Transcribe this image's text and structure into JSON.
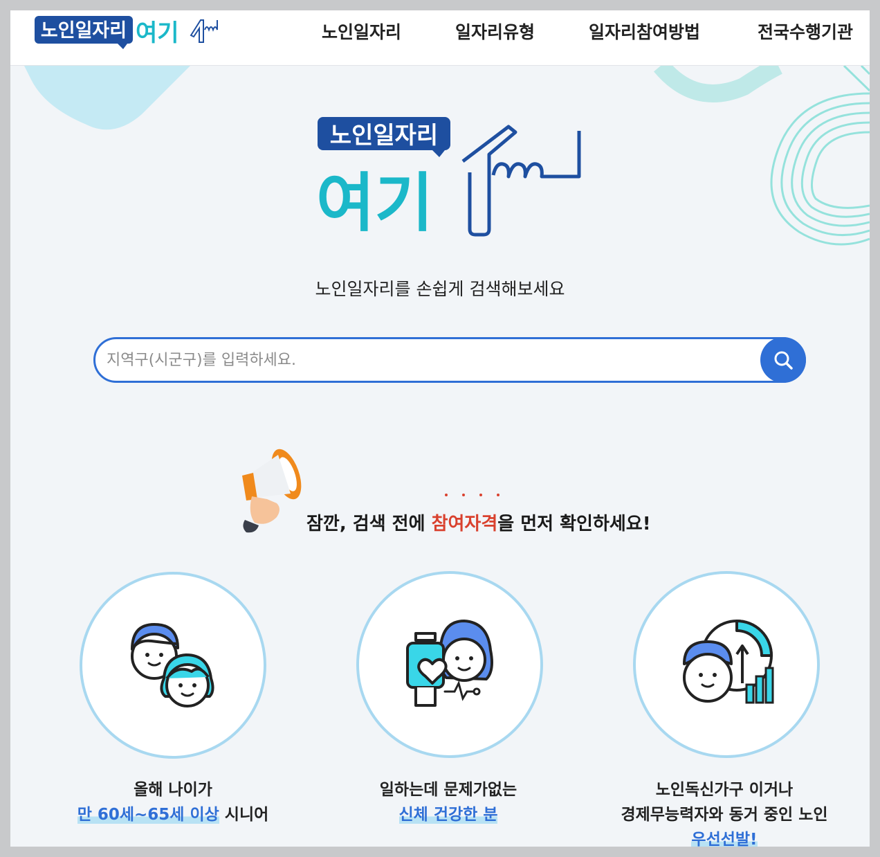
{
  "header": {
    "logo_top": "노인일자리",
    "logo_bottom": "여기",
    "nav": [
      "노인일자리",
      "일자리유형",
      "일자리참여방법",
      "전국수행기관"
    ]
  },
  "hero": {
    "logo_top": "노인일자리",
    "logo_bottom": "여기",
    "tagline": "노인일자리를 손쉽게 검색해보세요"
  },
  "search": {
    "placeholder": "지역구(시군구)를 입력하세요.",
    "value": ""
  },
  "notice": {
    "before": "잠깐, 검색 전에 ",
    "highlight": "참여자격",
    "after": "을 먼저 확인하세요!"
  },
  "cards": [
    {
      "line1": "올해 나이가",
      "highlight": "만 60세~65세 이상",
      "line2_after": " 시니어",
      "line3": ""
    },
    {
      "line1": "일하는데 문제가없는",
      "highlight": "신체 건강한 분",
      "line2_after": "",
      "line3": ""
    },
    {
      "line1": "노인독신가구 이거나",
      "highlight": "",
      "line2_after": "경제무능력자와 동거 중인 노인",
      "line3": "우선선발!"
    }
  ],
  "colors": {
    "brand_blue": "#1e4fa0",
    "accent_teal": "#1bb8c9",
    "search_blue": "#2f6fd6",
    "highlight_red": "#d9412e",
    "circle_border": "#a8d8f0"
  },
  "icons": [
    "search-icon",
    "megaphone-icon",
    "senior-couple-icon",
    "health-watch-icon",
    "senior-growth-icon"
  ]
}
